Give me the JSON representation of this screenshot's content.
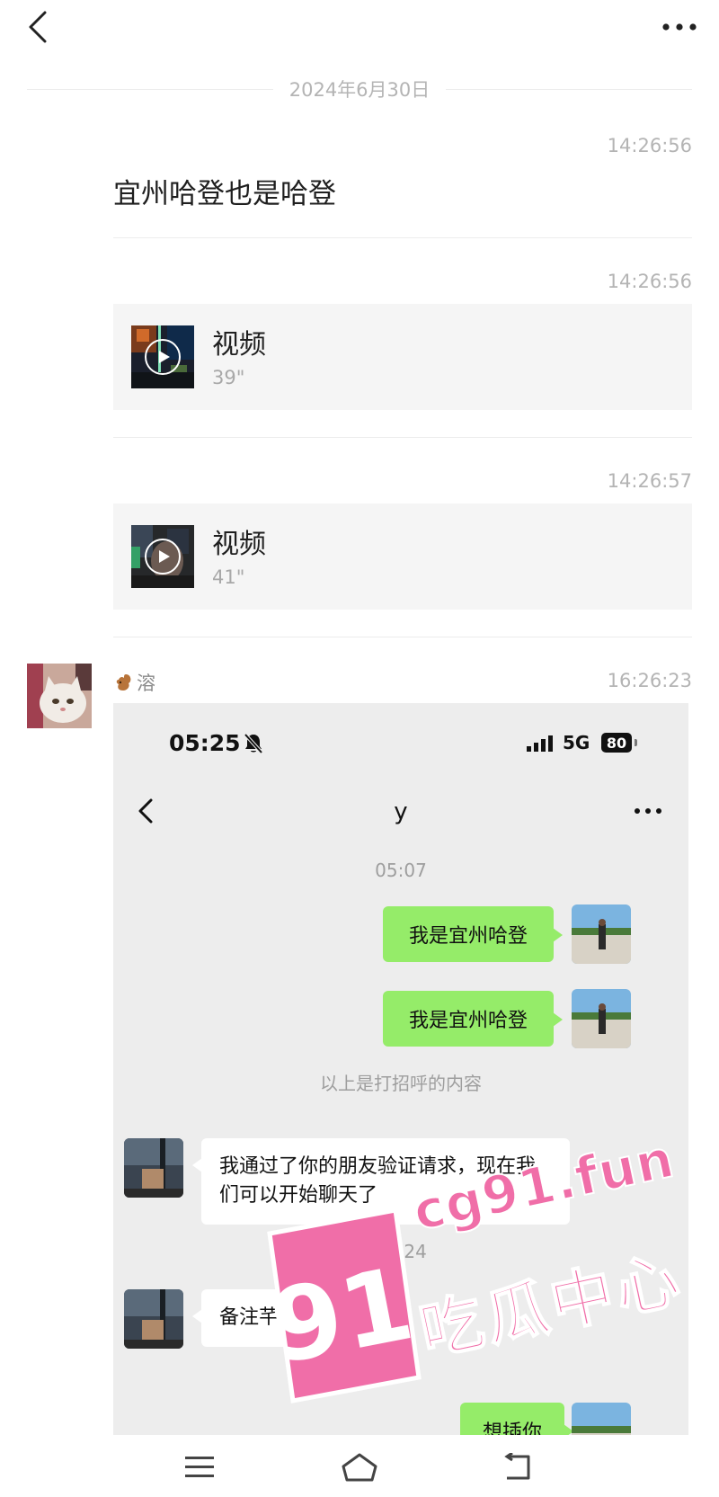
{
  "date_divider": "2024年6月30日",
  "messages": [
    {
      "time": "14:26:56",
      "text": "宜州哈登也是哈登"
    },
    {
      "time": "14:26:56",
      "label": "视频",
      "duration": "39\""
    },
    {
      "time": "14:26:57",
      "label": "视频",
      "duration": "41\""
    }
  ],
  "sender": {
    "name": "溶",
    "time": "16:26:23",
    "emoji_icon": "squirrel-emoji-icon"
  },
  "screenshot": {
    "status": {
      "time": "05:25",
      "network": "5G",
      "battery": "80"
    },
    "title": "y",
    "timestamps": [
      "05:07",
      "05:24"
    ],
    "outgoing": [
      "我是宜州哈登",
      "我是宜州哈登",
      "想插你"
    ],
    "hint": "以上是打招呼的内容",
    "incoming": [
      "我通过了你的朋友验证请求，现在我们可以开始聊天了",
      "备注芊芊"
    ]
  },
  "watermark": {
    "number": "91",
    "site": "cg91.fun",
    "name": "吃瓜中心"
  },
  "colors": {
    "green_bubble": "#95ec69",
    "watermark_pink": "#f06ea8",
    "separator": "#ececec"
  }
}
